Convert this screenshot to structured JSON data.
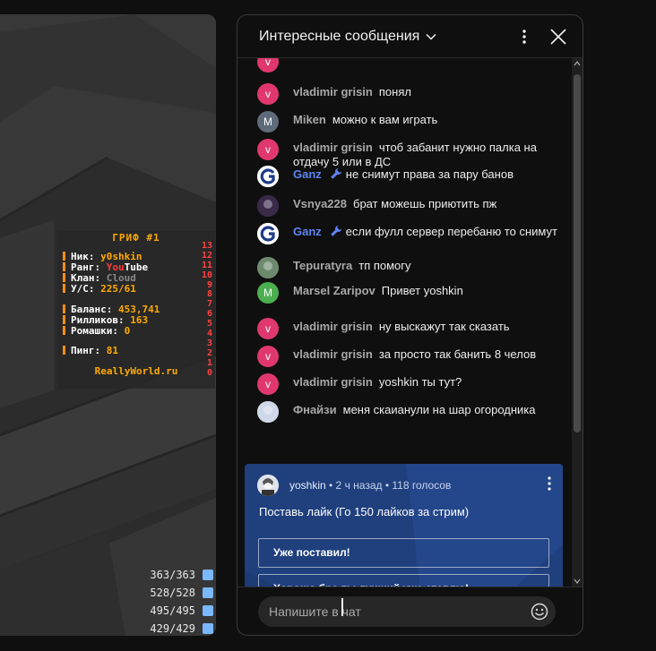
{
  "game": {
    "scoreboard": {
      "title": "ГРИФ #1",
      "rows": [
        {
          "key": "Ник:",
          "value": "y0shkin",
          "value2": ""
        },
        {
          "key": "Ранг:",
          "value": "You",
          "value2": "Tube"
        },
        {
          "key": "Клан:",
          "value": "Cloud",
          "value2": ""
        },
        {
          "key": "У/С:",
          "value": "225/61",
          "value2": ""
        },
        {
          "key": "Баланс:",
          "value": "453,741",
          "value2": ""
        },
        {
          "key": "Рилликов:",
          "value": "163",
          "value2": ""
        },
        {
          "key": "Ромашки:",
          "value": "0",
          "value2": ""
        },
        {
          "key": "Пинг:",
          "value": "81",
          "value2": ""
        }
      ],
      "site": "ReallyWorld.ru",
      "numbers": [
        "13",
        "12",
        "11",
        "10",
        "9",
        "8",
        "7",
        "6",
        "5",
        "4",
        "3",
        "2",
        "1",
        "0"
      ]
    },
    "armor": [
      "363/363",
      "528/528",
      "495/495",
      "429/429"
    ]
  },
  "chat": {
    "title": "Интересные сообщения",
    "messages": [
      {
        "author": "vladimir grisin",
        "text": "понял",
        "avatar_letter": "v",
        "avatar_color": "#e0386e"
      },
      {
        "author": "Miken",
        "text": "можно к вам играть",
        "avatar_letter": "M",
        "avatar_color": "#5f6b7a"
      },
      {
        "author": "vladimir grisin",
        "text": "чтоб забанит нужно палка на отдачу 5 или в ДС",
        "avatar_letter": "v",
        "avatar_color": "#e0386e"
      },
      {
        "author": "Ganz",
        "text": "не снимут права за пару банов",
        "avatar_letter": "G",
        "avatar_color": "#ffffff",
        "mod": true
      },
      {
        "author": "Vsnya228",
        "text": "брат можешь приютить пж",
        "avatar_letter": "",
        "avatar_color": "#3a2a4a"
      },
      {
        "author": "Ganz",
        "text": "если фулл сервер перебаню то снимут",
        "avatar_letter": "G",
        "avatar_color": "#ffffff",
        "mod": true
      },
      {
        "author": "Tepuratyra",
        "text": "тп помогу",
        "avatar_letter": "",
        "avatar_color": "#6e8a6e"
      },
      {
        "author": "Marsel Zaripov",
        "text": "Привет yoshkin",
        "avatar_letter": "M",
        "avatar_color": "#4caf50"
      },
      {
        "author": "vladimir grisin",
        "text": "ну выскажут так сказать",
        "avatar_letter": "v",
        "avatar_color": "#e0386e"
      },
      {
        "author": "vladimir grisin",
        "text": "за просто так банить 8 челов",
        "avatar_letter": "v",
        "avatar_color": "#e0386e"
      },
      {
        "author": "vladimir grisin",
        "text": "yoshkin ты тут?",
        "avatar_letter": "v",
        "avatar_color": "#e0386e"
      },
      {
        "author": "Фнайзи",
        "text": "меня скаианули на шар огородника",
        "avatar_letter": "",
        "avatar_color": "#cfd8e8"
      }
    ],
    "poll": {
      "author": "yoshkin",
      "meta": " • 2 ч назад • 118 голосов",
      "question": "Поставь лайк (Го 150 лайков за стрим)",
      "options": [
        "Уже поставил!",
        "Хорошо бро ты лучший уже ставлю!"
      ]
    },
    "input_placeholder": "Напишите в чат"
  },
  "colors": {
    "poll_bg": "#1f3f7d",
    "mod_name": "#5e84f1",
    "panel_bg": "#0f0f0f"
  }
}
